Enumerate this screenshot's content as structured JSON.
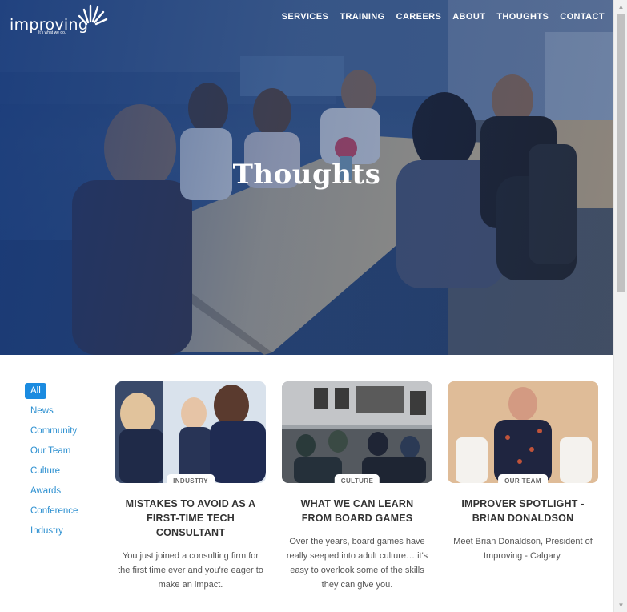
{
  "brand": {
    "name": "improving",
    "tagline": "It's what we do."
  },
  "nav": {
    "items": [
      "SERVICES",
      "TRAINING",
      "CAREERS",
      "ABOUT",
      "THOUGHTS",
      "CONTACT"
    ]
  },
  "hero": {
    "title": "Thoughts"
  },
  "filters": {
    "items": [
      "All",
      "News",
      "Community",
      "Our Team",
      "Culture",
      "Awards",
      "Conference",
      "Industry"
    ],
    "active": "All"
  },
  "cards": [
    {
      "tag": "INDUSTRY",
      "title": "MISTAKES TO AVOID AS A FIRST-TIME TECH CONSULTANT",
      "excerpt": "You just joined a consulting firm for the first time ever and you're eager to make an impact."
    },
    {
      "tag": "CULTURE",
      "title": "WHAT WE CAN LEARN FROM BOARD GAMES",
      "excerpt": "Over the years, board games have really seeped into adult culture… it's easy to overlook some of the skills they can give you."
    },
    {
      "tag": "OUR TEAM",
      "title": "IMPROVER SPOTLIGHT - BRIAN DONALDSON",
      "excerpt": "Meet Brian Donaldson, President of Improving - Calgary."
    }
  ],
  "colors": {
    "accent": "#1b8be0",
    "link": "#2b8fd0",
    "hero_overlay": "#1e3c78"
  },
  "icons": {
    "scroll_up": "scroll-up-arrow-icon",
    "scroll_down": "scroll-down-arrow-icon",
    "logo_mark": "sunburst-logo-icon"
  }
}
